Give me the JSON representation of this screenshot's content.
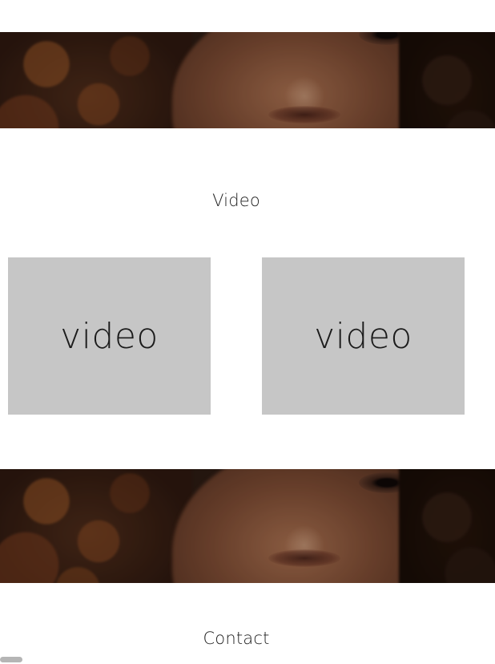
{
  "sections": {
    "video": {
      "title": "Video",
      "items": [
        {
          "label": "video"
        },
        {
          "label": "video"
        }
      ]
    },
    "contact": {
      "title": "Contact"
    }
  },
  "colors": {
    "background": "#ffffff",
    "video_placeholder": "#c6c6c6",
    "text": "#222222"
  },
  "banners": [
    {
      "icon": "portrait-photo"
    },
    {
      "icon": "portrait-photo"
    }
  ]
}
